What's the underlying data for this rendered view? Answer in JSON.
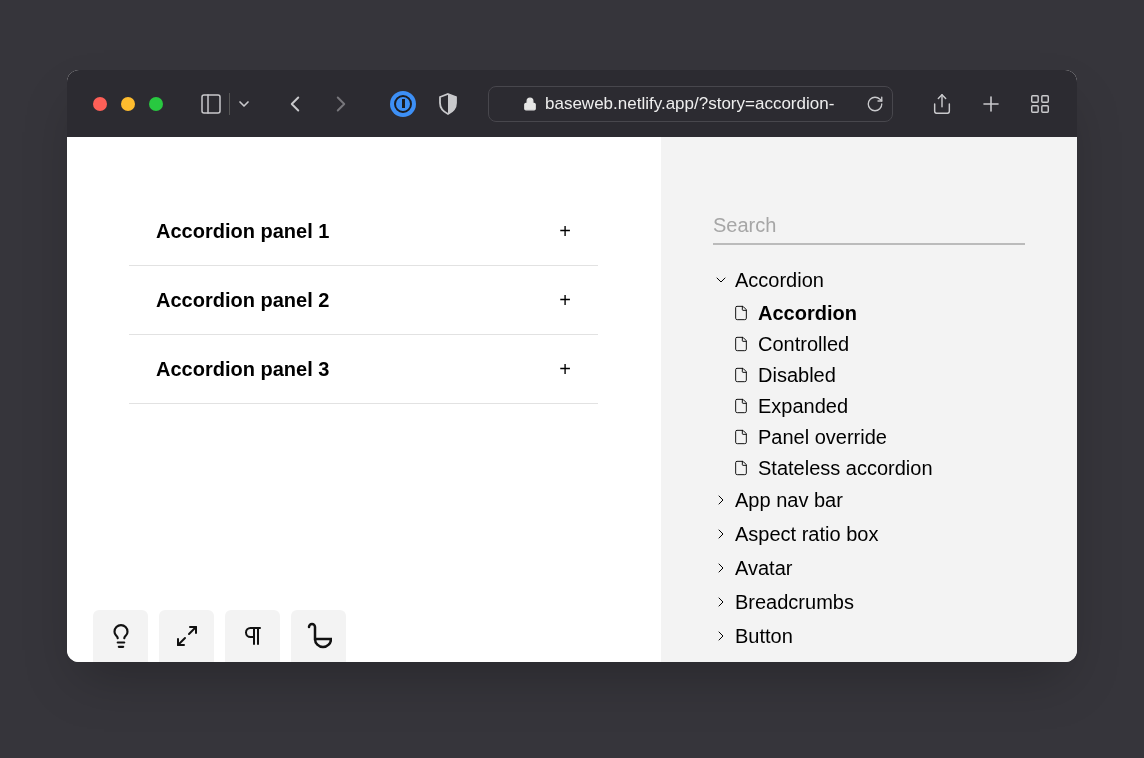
{
  "browser": {
    "url": "baseweb.netlify.app/?story=accordion-"
  },
  "accordion": [
    {
      "title": "Accordion panel 1",
      "toggle": "+"
    },
    {
      "title": "Accordion panel 2",
      "toggle": "+"
    },
    {
      "title": "Accordion panel 3",
      "toggle": "+"
    }
  ],
  "sidebar": {
    "search": {
      "placeholder": "Search"
    },
    "items": [
      {
        "label": "Accordion",
        "expanded": true,
        "children": [
          {
            "label": "Accordion",
            "selected": true
          },
          {
            "label": "Controlled",
            "selected": false
          },
          {
            "label": "Disabled",
            "selected": false
          },
          {
            "label": "Expanded",
            "selected": false
          },
          {
            "label": "Panel override",
            "selected": false
          },
          {
            "label": "Stateless accordion",
            "selected": false
          }
        ]
      },
      {
        "label": "App nav bar",
        "expanded": false
      },
      {
        "label": "Aspect ratio box",
        "expanded": false
      },
      {
        "label": "Avatar",
        "expanded": false
      },
      {
        "label": "Breadcrumbs",
        "expanded": false
      },
      {
        "label": "Button",
        "expanded": false
      }
    ]
  }
}
